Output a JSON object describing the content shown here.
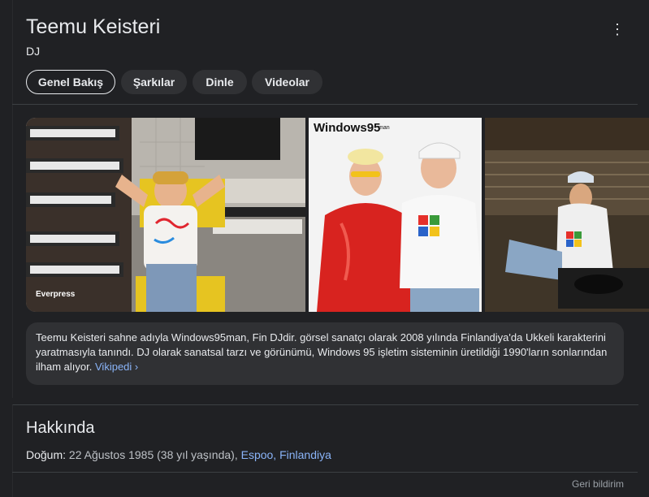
{
  "header": {
    "title": "Teemu Keisteri",
    "subtitle": "DJ"
  },
  "tabs": [
    {
      "label": "Genel Bakış",
      "active": true
    },
    {
      "label": "Şarkılar",
      "active": false
    },
    {
      "label": "Dinle",
      "active": false
    },
    {
      "label": "Videolar",
      "active": false
    }
  ],
  "images": [
    {
      "caption": "Everpress",
      "icon": "photo-studio-synths"
    },
    {
      "caption": "",
      "logo_text": "Windows95man",
      "icon": "photo-duo"
    },
    {
      "caption": "",
      "icon": "photo-turntable"
    }
  ],
  "description": {
    "text": "Teemu Keisteri sahne adıyla Windows95man, Fin DJdir. görsel sanatçı olarak 2008 yılında Finlandiya'da Ukkeli karakterini yaratmasıyla tanındı. DJ olarak sanatsal tarzı ve görünümü, Windows 95 işletim sisteminin üretildiği 1990'ların sonlarından ilham alıyor.",
    "source_link": "Vikipedi",
    "source_chevron": "›"
  },
  "about": {
    "title": "Hakkında",
    "born_label": "Doğum:",
    "born_value": " 22 Ağustos 1985 (38 yıl yaşında), ",
    "born_place": "Espoo, Finlandiya"
  },
  "feedback": "Geri bildirim",
  "colors": {
    "background": "#202124",
    "card": "#303134",
    "link": "#8ab4f8",
    "text": "#e8eaed"
  }
}
